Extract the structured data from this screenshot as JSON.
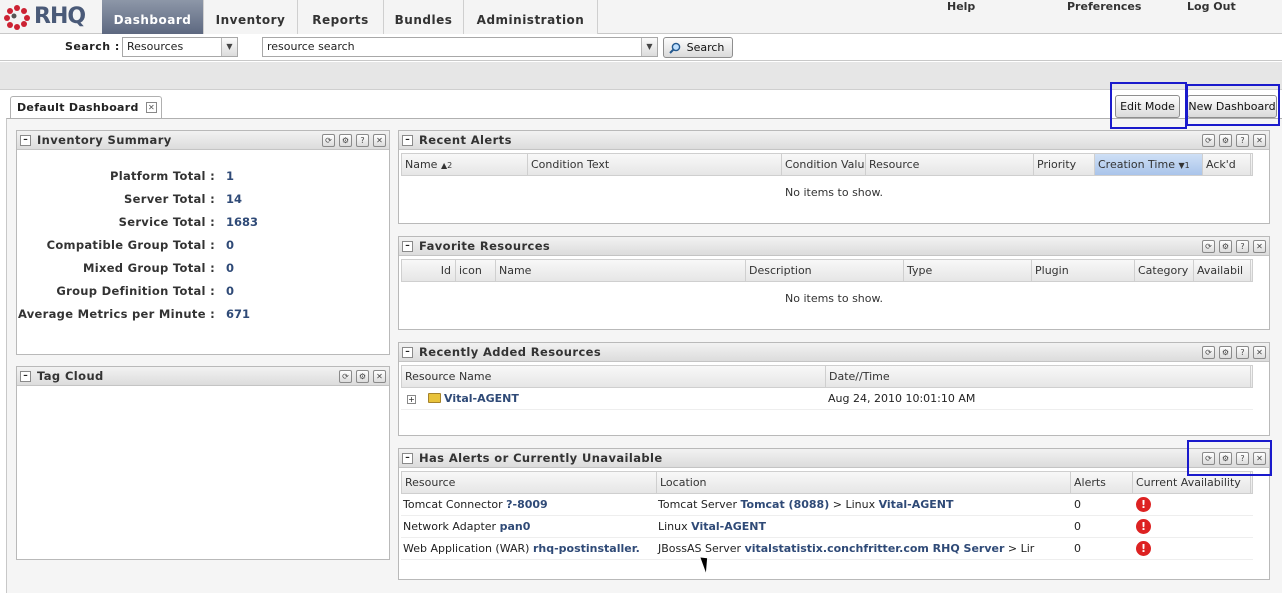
{
  "app": {
    "logo_text": "RHQ"
  },
  "nav": {
    "tabs": [
      {
        "label": "Dashboard"
      },
      {
        "label": "Inventory"
      },
      {
        "label": "Reports"
      },
      {
        "label": "Bundles"
      },
      {
        "label": "Administration"
      }
    ],
    "help": "Help",
    "preferences": "Preferences",
    "logout": "Log Out"
  },
  "search": {
    "label": "Search :",
    "type_value": "Resources",
    "query_value": "resource search",
    "button_label": "Search"
  },
  "dashboard": {
    "tab_label": "Default Dashboard",
    "edit_mode_label": "Edit Mode",
    "new_dashboard_label": "New Dashboard"
  },
  "portlets": {
    "inventory_summary": {
      "title": "Inventory Summary",
      "rows": [
        {
          "label": "Platform Total :",
          "value": "1"
        },
        {
          "label": "Server Total :",
          "value": "14"
        },
        {
          "label": "Service Total :",
          "value": "1683"
        },
        {
          "label": "Compatible Group Total :",
          "value": "0"
        },
        {
          "label": "Mixed Group Total :",
          "value": "0"
        },
        {
          "label": "Group Definition Total :",
          "value": "0"
        },
        {
          "label": "Average Metrics per Minute :",
          "value": "671"
        }
      ]
    },
    "tag_cloud": {
      "title": "Tag Cloud"
    },
    "recent_alerts": {
      "title": "Recent Alerts",
      "columns": [
        "Name",
        "Condition Text",
        "Condition Valu",
        "Resource",
        "Priority",
        "Creation Time",
        "Ack'd"
      ],
      "sort_marks": {
        "name": "2",
        "creation_time": "1"
      },
      "empty_text": "No items to show."
    },
    "favorite_resources": {
      "title": "Favorite Resources",
      "columns": [
        "Id",
        "icon",
        "Name",
        "Description",
        "Type",
        "Plugin",
        "Category",
        "Availabil"
      ],
      "empty_text": "No items to show."
    },
    "recently_added": {
      "title": "Recently Added Resources",
      "columns": [
        "Resource Name",
        "Date//Time"
      ],
      "rows": [
        {
          "name": "Vital-AGENT",
          "datetime": "Aug 24, 2010 10:01:10 AM"
        }
      ]
    },
    "has_alerts": {
      "title": "Has Alerts or Currently Unavailable",
      "columns": [
        "Resource",
        "Location",
        "Alerts",
        "Current Availability"
      ],
      "rows": [
        {
          "res_prefix": "Tomcat Connector",
          "res_link": "?-8009",
          "loc_1": "Tomcat Server",
          "loc_link_1": "Tomcat (8088)",
          "loc_2": "> Linux",
          "loc_link_2": "Vital-AGENT",
          "loc_3": "",
          "alerts": "0"
        },
        {
          "res_prefix": "Network Adapter",
          "res_link": "pan0",
          "loc_1": "Linux",
          "loc_link_1": "Vital-AGENT",
          "loc_2": "",
          "loc_link_2": "",
          "loc_3": "",
          "alerts": "0"
        },
        {
          "res_prefix": "Web Application (WAR)",
          "res_link": "rhq-postinstaller.",
          "loc_1": "JBossAS Server",
          "loc_link_1": "vitalstatistix.conchfritter.com RHQ Server",
          "loc_2": "> Lir",
          "loc_link_2": "",
          "loc_3": "",
          "alerts": "0"
        }
      ]
    }
  },
  "icons": {
    "refresh": "⟳",
    "settings": "⚙",
    "help": "?",
    "close": "✕",
    "minimize": "–",
    "expand": "+",
    "error": "!",
    "search": "magnifier",
    "dropdown": "▼"
  },
  "colors": {
    "accent": "#5d6880",
    "link": "#2f4a77",
    "error": "#dd2222",
    "highlight": "#1a1acc"
  }
}
